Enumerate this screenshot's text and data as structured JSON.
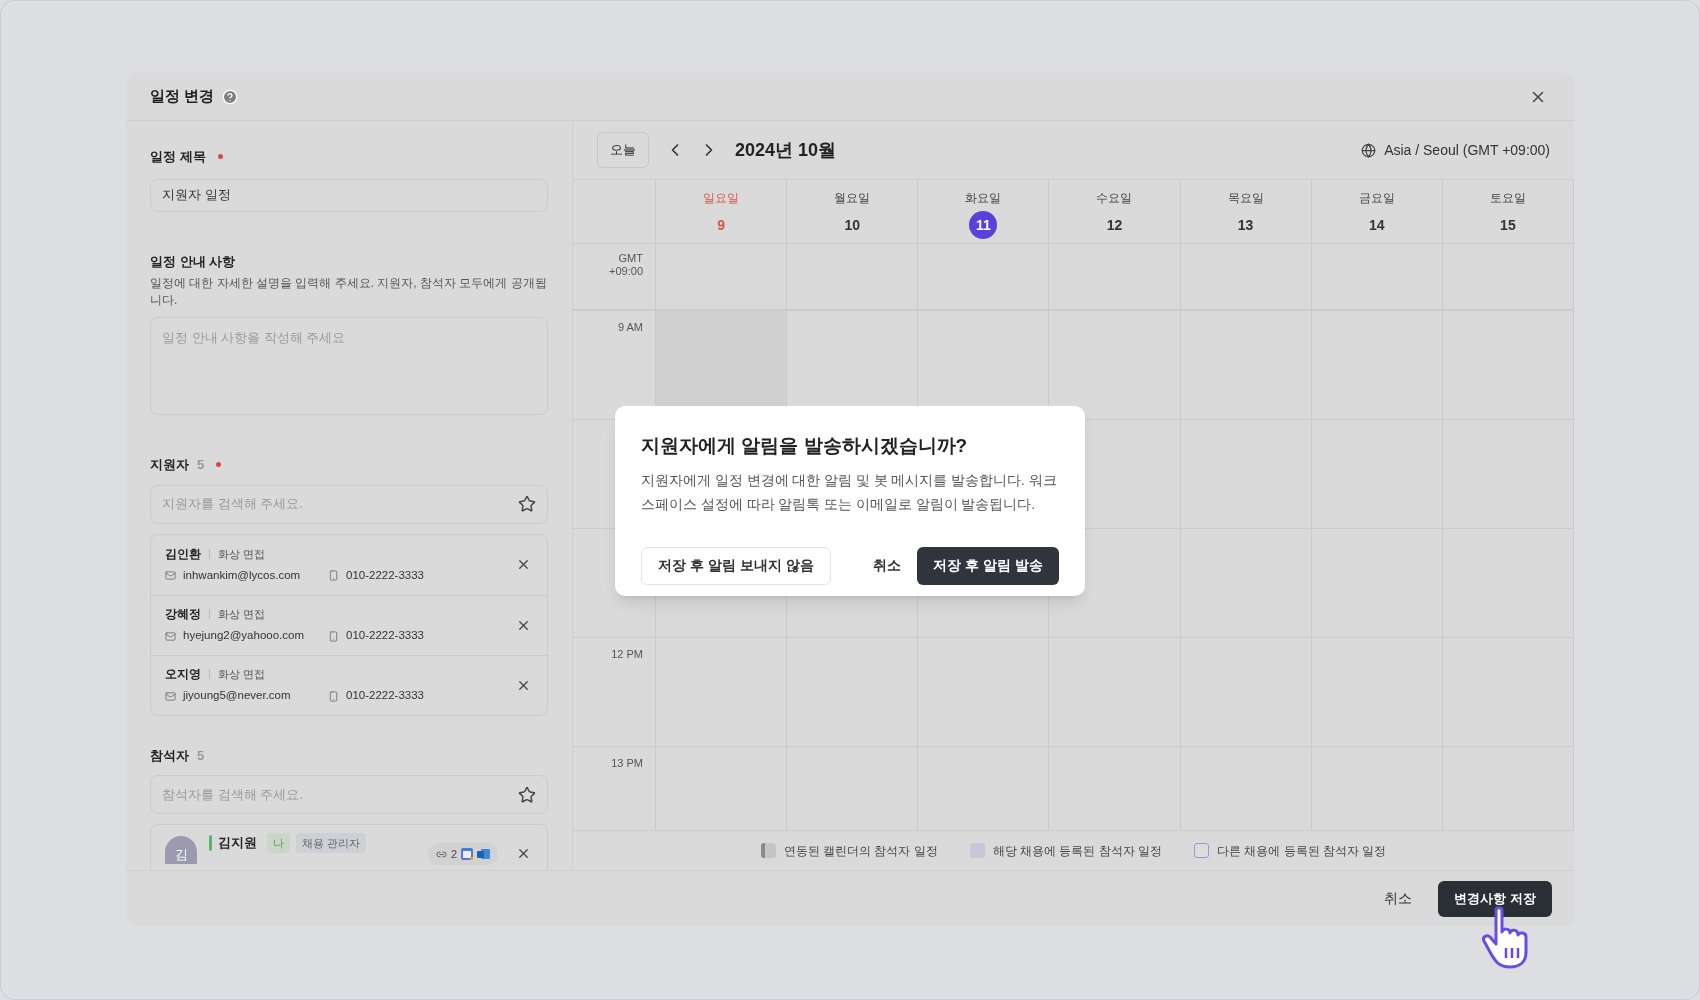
{
  "dialog": {
    "title": "일정 변경"
  },
  "form": {
    "title_field": {
      "label": "일정 제목",
      "required": true,
      "value": "지원자 일정"
    },
    "description": {
      "label": "일정 안내 사항",
      "help": "일정에 대한 자세한 설명을 입력해 주세요. 지원자, 참석자 모두에게 공개됩니다.",
      "placeholder": "일정 안내 사항을 작성해 주세요"
    },
    "applicants": {
      "label": "지원자",
      "count": "5",
      "required": true,
      "search_placeholder": "지원자를 검색해 주세요.",
      "items": [
        {
          "name": "김인환",
          "type": "화상 면접",
          "email": "inhwankim@lycos.com",
          "phone": "010-2222-3333"
        },
        {
          "name": "강혜정",
          "type": "화상 면접",
          "email": "hyejung2@yahooo.com",
          "phone": "010-2222-3333"
        },
        {
          "name": "오지영",
          "type": "화상 면접",
          "email": "jiyoung5@never.com",
          "phone": "010-2222-3333"
        }
      ]
    },
    "attendees": {
      "label": "참석자",
      "count": "5",
      "search_placeholder": "참석자를 검색해 주세요.",
      "items": [
        {
          "avatar": "김",
          "name": "김지원",
          "me_badge": "나",
          "role": "채용 관리자",
          "links": "2"
        }
      ]
    }
  },
  "calendar": {
    "today_button": "오늘",
    "month": "2024년 10월",
    "timezone": "Asia / Seoul (GMT +09:00)",
    "allday_label": "GMT +09:00",
    "days": [
      {
        "weekday": "일요일",
        "date": "9",
        "holiday": true,
        "selected": false
      },
      {
        "weekday": "월요일",
        "date": "10",
        "holiday": false,
        "selected": false
      },
      {
        "weekday": "화요일",
        "date": "11",
        "holiday": false,
        "selected": true
      },
      {
        "weekday": "수요일",
        "date": "12",
        "holiday": false,
        "selected": false
      },
      {
        "weekday": "목요일",
        "date": "13",
        "holiday": false,
        "selected": false
      },
      {
        "weekday": "금요일",
        "date": "14",
        "holiday": false,
        "selected": false
      },
      {
        "weekday": "토요일",
        "date": "15",
        "holiday": false,
        "selected": false
      }
    ],
    "rows": [
      {
        "time": "9 AM"
      },
      {},
      {},
      {
        "time": "12 PM"
      },
      {
        "time": "13 PM"
      }
    ],
    "legend": [
      {
        "kind": "synced",
        "label": "연동된 캘린더의 참석자 일정"
      },
      {
        "kind": "registered",
        "label": "해당 채용에 등록된 참석자 일정"
      },
      {
        "kind": "other",
        "label": "다른 채용에 등록된 참석자 일정"
      }
    ]
  },
  "modal": {
    "title": "지원자에게 알림을 발송하시겠습니까?",
    "body": "지원자에게 일정 변경에 대한 알림 및 봇 메시지를 발송합니다. 워크스페이스 설정에 따라 알림톡 또는 이메일로 알림이 발송됩니다.",
    "buttons": [
      {
        "label": "저장 후 알림 보내지 않음",
        "kind": "outline"
      },
      {
        "label": "취소",
        "kind": "text"
      },
      {
        "label": "저장 후 알림 발송",
        "kind": "primary"
      }
    ]
  },
  "footer": {
    "buttons": [
      {
        "label": "취소",
        "kind": "text"
      },
      {
        "label": "변경사항 저장",
        "kind": "primary"
      }
    ]
  }
}
